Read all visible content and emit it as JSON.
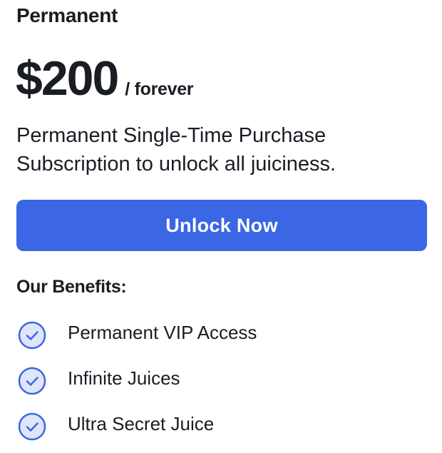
{
  "plan": {
    "title": "Permanent",
    "price": "$200",
    "period": "/ forever",
    "description": "Permanent Single-Time Purchase Subscription to unlock all juiciness.",
    "button_label": "Unlock Now"
  },
  "benefits": {
    "heading": "Our Benefits:",
    "items": [
      {
        "label": "Permanent VIP Access",
        "icon": "check-circle-icon"
      },
      {
        "label": "Infinite Juices",
        "icon": "check-circle-icon"
      },
      {
        "label": "Ultra Secret Juice",
        "icon": "check-circle-icon"
      }
    ]
  },
  "colors": {
    "accent": "#3b66e4",
    "check_fill": "#dfe6fb",
    "check_stroke": "#3b66e4",
    "text": "#1a1d24"
  }
}
